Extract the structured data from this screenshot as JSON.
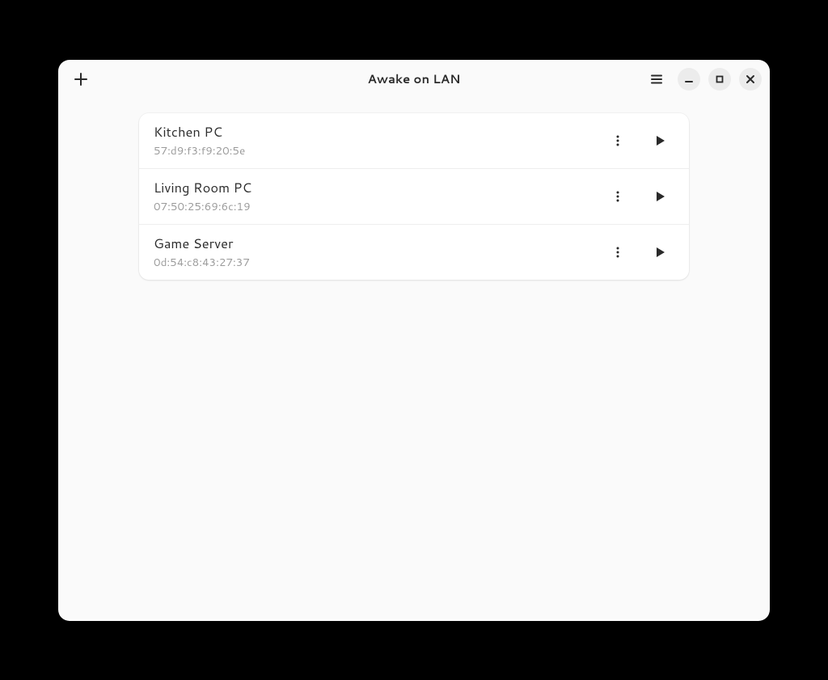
{
  "header": {
    "title": "Awake on LAN"
  },
  "devices": [
    {
      "name": "Kitchen PC",
      "mac": "57:d9:f3:f9:20:5e"
    },
    {
      "name": "Living Room PC",
      "mac": "07:50:25:69:6c:19"
    },
    {
      "name": "Game Server",
      "mac": "0d:54:c8:43:27:37"
    }
  ]
}
